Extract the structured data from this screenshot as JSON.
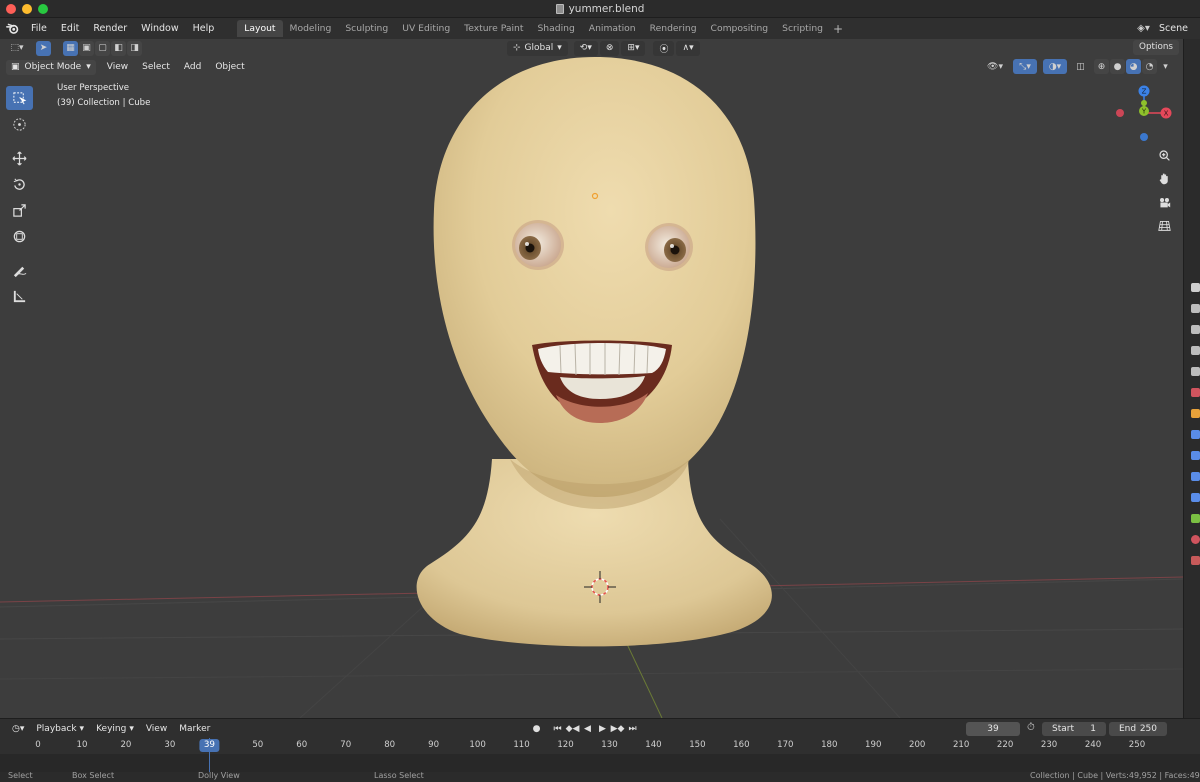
{
  "window": {
    "title": "yummer.blend"
  },
  "topbar": {
    "menus": [
      "File",
      "Edit",
      "Render",
      "Window",
      "Help"
    ],
    "workspaces": [
      "Layout",
      "Modeling",
      "Sculpting",
      "UV Editing",
      "Texture Paint",
      "Shading",
      "Animation",
      "Rendering",
      "Compositing",
      "Scripting"
    ],
    "active_workspace": "Layout",
    "scene_label": "Scene"
  },
  "viewport_header": {
    "transform_orientation": "Global",
    "options_label": "Options",
    "mode": "Object Mode",
    "menus": [
      "View",
      "Select",
      "Add",
      "Object"
    ]
  },
  "viewport": {
    "perspective_label": "User Perspective",
    "collection_label": "(39) Collection | Cube"
  },
  "gizmo": {
    "z_label": "Z",
    "y_label": "Y",
    "x_label": "X"
  },
  "timeline": {
    "menus": [
      "Playback",
      "Keying",
      "View",
      "Marker"
    ],
    "current_frame": "39",
    "start_label": "Start",
    "start_value": "1",
    "end_label": "End",
    "end_value": "250",
    "ruler_ticks": [
      "0",
      "10",
      "20",
      "30",
      "40",
      "50",
      "60",
      "70",
      "80",
      "90",
      "100",
      "110",
      "120",
      "130",
      "140",
      "150",
      "160",
      "170",
      "180",
      "190",
      "200",
      "210",
      "220",
      "230",
      "240",
      "250"
    ]
  },
  "statusbar": {
    "items": [
      "Select",
      "Box Select",
      "Dolly View",
      "Lasso Select"
    ],
    "stats": "Collection | Cube | Verts:49,952 | Faces:49"
  },
  "colors": {
    "accent": "#4772b3",
    "axis_x": "#e5485a",
    "axis_y": "#8ec12b",
    "axis_z": "#3b82e8",
    "skin": "#e6d2a5"
  },
  "icons": {
    "logo": "blender-logo-icon",
    "scene": "scene-icon"
  }
}
